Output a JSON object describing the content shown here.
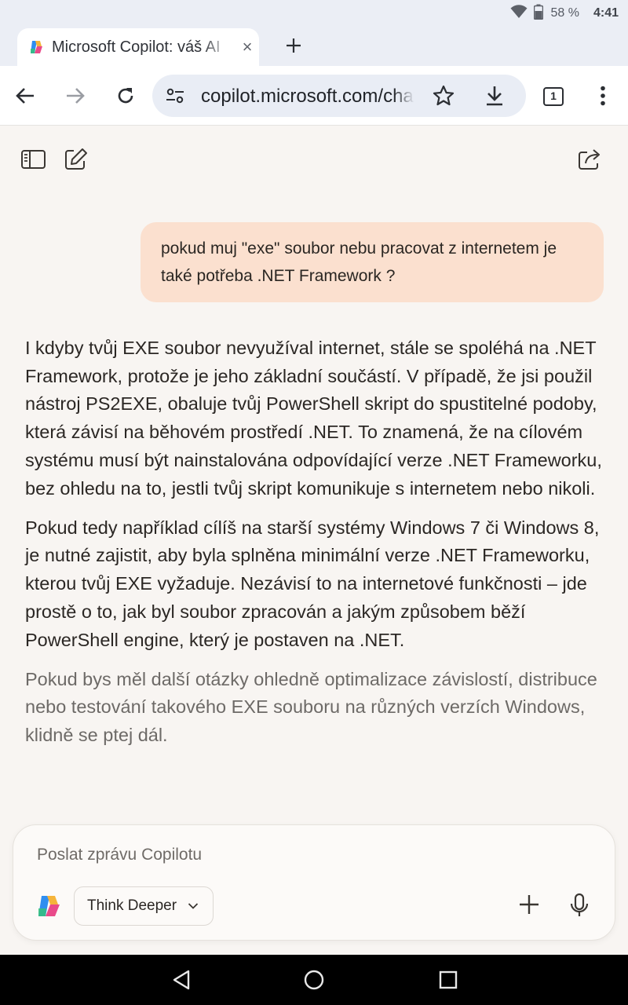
{
  "status_bar": {
    "battery": "58 %",
    "time": "4:41",
    "icons": [
      "wifi-icon",
      "battery-icon"
    ]
  },
  "tab": {
    "title": "Microsoft Copilot: váš AI",
    "close": "×"
  },
  "toolbar": {
    "url": "copilot.microsoft.com/chats",
    "tab_count": "1"
  },
  "chat": {
    "user_message": "pokud muj \"exe\" soubor nebu pracovat z internetem je také potřeba .NET Framework ?",
    "response": [
      "I kdyby tvůj EXE soubor nevyužíval internet, stále se spoléhá na .NET Framework, protože je jeho základní součástí. V případě, že jsi použil nástroj PS2EXE, obaluje tvůj PowerShell skript do spustitelné podoby, která závisí na běhovém prostředí .NET. To znamená, že na cílovém systému musí být nainstalována odpovídající verze .NET Frameworku, bez ohledu na to, jestli tvůj skript komunikuje s internetem nebo nikoli.",
      "Pokud tedy například cílíš na starší systémy Windows 7 či Windows 8, je nutné zajistit, aby byla splněna minimální verze .NET Frameworku, kterou tvůj EXE vyžaduje. Nezávisí to na internetové funkčnosti – jde prostě o to, jak byl soubor zpracován a jakým způsobem běží PowerShell engine, který je postaven na .NET.",
      "Pokud bys měl další otázky ohledně optimalizace závislostí, distribuce nebo testování takového EXE souboru na různých verzích Windows, klidně se ptej dál."
    ]
  },
  "composer": {
    "placeholder": "Poslat zprávu Copilotu",
    "mode_label": "Think Deeper"
  },
  "colors": {
    "page_bg": "#f8f5f2",
    "user_bubble": "#fbe0cf",
    "chrome_bg": "#ebeef5",
    "omnibox_bg": "#e9edf5"
  }
}
